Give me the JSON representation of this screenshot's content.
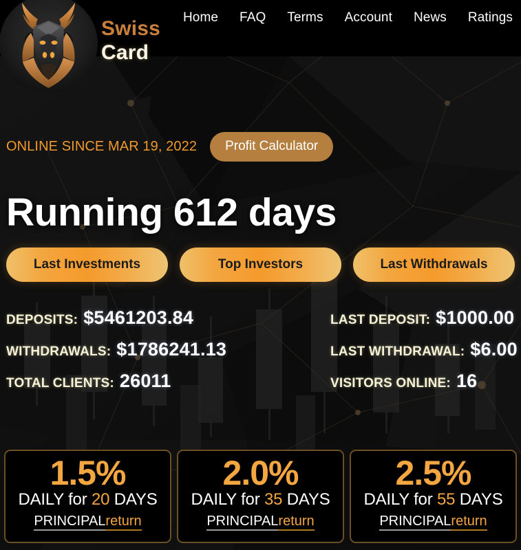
{
  "brand": {
    "line1": "Swiss",
    "line2": "Card",
    "logo_icon": "bull-head-logo",
    "accent_color": "#c9803c",
    "text_color": "#fdf6e4"
  },
  "nav": {
    "items": [
      {
        "label": "Home"
      },
      {
        "label": "FAQ"
      },
      {
        "label": "Terms"
      },
      {
        "label": "Account"
      },
      {
        "label": "News"
      },
      {
        "label": "Ratings"
      }
    ]
  },
  "hero": {
    "online_since": "ONLINE SINCE MAR 19, 2022",
    "online_since_color": "#f09a2b",
    "profit_calculator_label": "Profit Calculator",
    "profit_calculator_color": "#b5803f",
    "headline": "Running 612 days"
  },
  "pills": [
    {
      "label": "Last Investments"
    },
    {
      "label": "Top Investors"
    },
    {
      "label": "Last Withdrawals"
    }
  ],
  "stats": {
    "left": [
      {
        "label": "DEPOSITS:",
        "value": "$5461203.84"
      },
      {
        "label": "WITHDRAWALS:",
        "value": "$1786241.13"
      },
      {
        "label": "TOTAL CLIENTS:",
        "value": "26011"
      }
    ],
    "right": [
      {
        "label": "LAST DEPOSIT:",
        "value": "$1000.00"
      },
      {
        "label": "LAST WITHDRAWAL:",
        "value": "$6.00"
      },
      {
        "label": "VISITORS ONLINE:",
        "value": "16"
      }
    ],
    "label_color": "#f7f2d6",
    "value_color": "#ffffff"
  },
  "plans": [
    {
      "percent": "1.5%",
      "daily_prefix": "DAILY for ",
      "days": "20",
      "daily_suffix": " DAYS",
      "principal_label": "PRINCIPAL",
      "return_label": "return"
    },
    {
      "percent": "2.0%",
      "daily_prefix": "DAILY for ",
      "days": "35",
      "daily_suffix": " DAYS",
      "principal_label": "PRINCIPAL",
      "return_label": "return"
    },
    {
      "percent": "2.5%",
      "daily_prefix": "DAILY for ",
      "days": "55",
      "daily_suffix": " DAYS",
      "principal_label": "PRINCIPAL",
      "return_label": "return"
    }
  ],
  "theme": {
    "accent_orange": "#f4a641",
    "card_border": "#6b5024",
    "page_bg": "#111111"
  }
}
